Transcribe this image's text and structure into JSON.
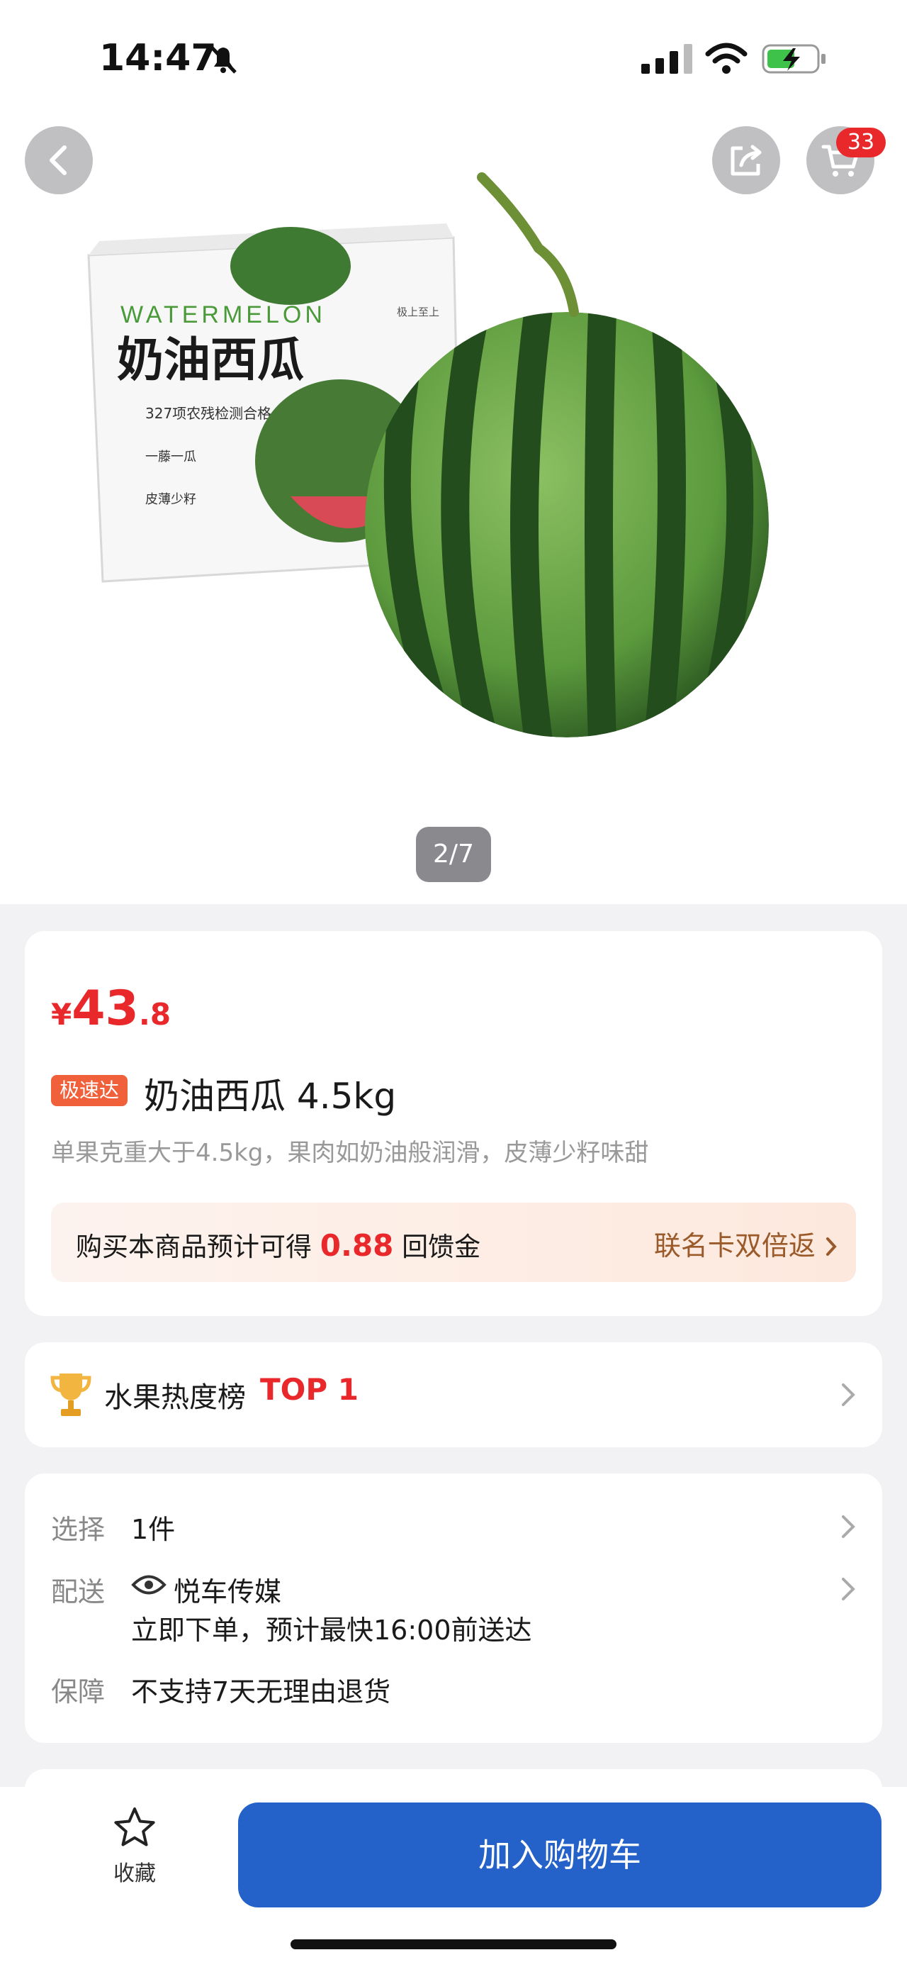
{
  "status_bar": {
    "time": "14:47"
  },
  "header": {
    "cart_count": "33",
    "pager": "2/7"
  },
  "hero_image": {
    "box_label_en": "WATERMELON",
    "box_label_cn": "奶油西瓜",
    "box_lines": [
      "327项农残检测合格",
      "一藤一瓜",
      "皮薄少籽"
    ],
    "box_brand": "极上至上"
  },
  "product": {
    "price_symbol": "¥",
    "price_int": "43",
    "price_dec": ".8",
    "tag": "极速达",
    "title": "奶油西瓜 4.5kg",
    "subtitle": "单果克重大于4.5kg，果肉如奶油般润滑，皮薄少籽味甜",
    "cashback_prefix": "购买本商品预计可得",
    "cashback_amount": "0.88",
    "cashback_suffix": "回馈金",
    "cashback_link": "联名卡双倍返"
  },
  "ranking": {
    "label": "水果热度榜",
    "rank": "TOP 1"
  },
  "details": {
    "select_label": "选择",
    "select_value": "1件",
    "delivery_label": "配送",
    "delivery_store": "悦车传媒",
    "delivery_eta": "立即下单，预计最快16:00前送达",
    "guarantee_label": "保障",
    "guarantee_value": "不支持7天无理由退货"
  },
  "bottom_bar": {
    "favorite_label": "收藏",
    "add_to_cart": "加入购物车"
  },
  "colors": {
    "accent": "#e8282b",
    "primary_button": "#2461c9",
    "tag": "#f0603a"
  }
}
